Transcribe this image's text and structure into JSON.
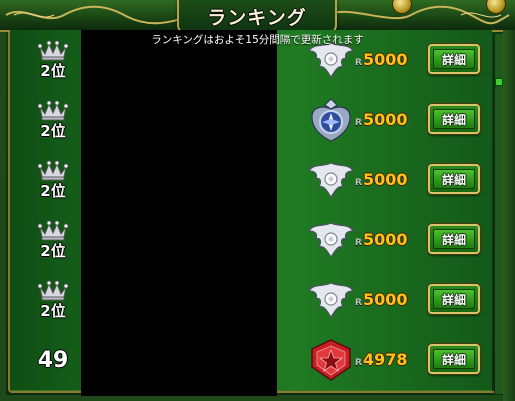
{
  "header": {
    "title": "ランキング",
    "notice": "ランキングはおよそ15分間隔で更新されます"
  },
  "colors": {
    "rate_gold": "#ffc21a",
    "row_green": "#1f7a22",
    "frame_gold": "#b9a246"
  },
  "rows": [
    {
      "rank_text": "2位",
      "rank_style": "crown",
      "emblem": "silver-wing-emblem-icon",
      "rate_prefix": "R",
      "rate": "5000",
      "detail_label": "詳細"
    },
    {
      "rank_text": "2位",
      "rank_style": "crown",
      "emblem": "blue-crest-emblem-icon",
      "rate_prefix": "R",
      "rate": "5000",
      "detail_label": "詳細"
    },
    {
      "rank_text": "2位",
      "rank_style": "crown",
      "emblem": "silver-wing-emblem-icon",
      "rate_prefix": "R",
      "rate": "5000",
      "detail_label": "詳細"
    },
    {
      "rank_text": "2位",
      "rank_style": "crown",
      "emblem": "silver-wing-emblem-icon",
      "rate_prefix": "R",
      "rate": "5000",
      "detail_label": "詳細"
    },
    {
      "rank_text": "2位",
      "rank_style": "crown",
      "emblem": "silver-wing-emblem-icon",
      "rate_prefix": "R",
      "rate": "5000",
      "detail_label": "詳細"
    },
    {
      "rank_text": "49",
      "rank_style": "number",
      "emblem": "red-star-emblem-icon",
      "rate_prefix": "R",
      "rate": "4978",
      "detail_label": "詳細"
    }
  ]
}
